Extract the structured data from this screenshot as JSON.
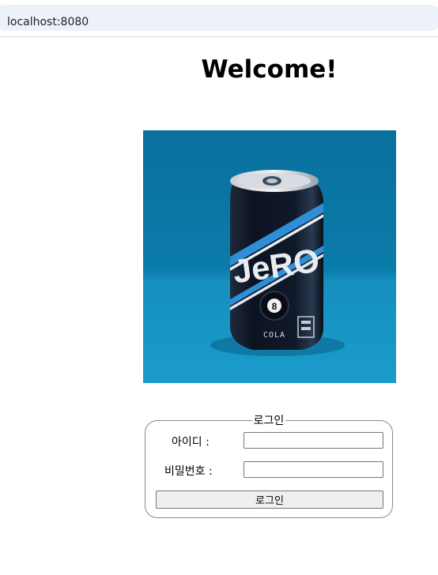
{
  "browser": {
    "url": "localhost:8080"
  },
  "page": {
    "title": "Welcome!"
  },
  "product": {
    "brand_text": "JeRO",
    "ball_number": "8",
    "can_label": "COLA"
  },
  "login": {
    "legend": "로그인",
    "id_label": "아이디 :",
    "id_value": "",
    "password_label": "비밀번호 :",
    "password_value": "",
    "submit_label": "로그인"
  },
  "colors": {
    "address_bar_bg": "#edf1f9",
    "image_background": "#0a78a8",
    "can_body": "#0d1420",
    "can_stripe": "#2f8fd6",
    "button_bg": "#efefef"
  }
}
